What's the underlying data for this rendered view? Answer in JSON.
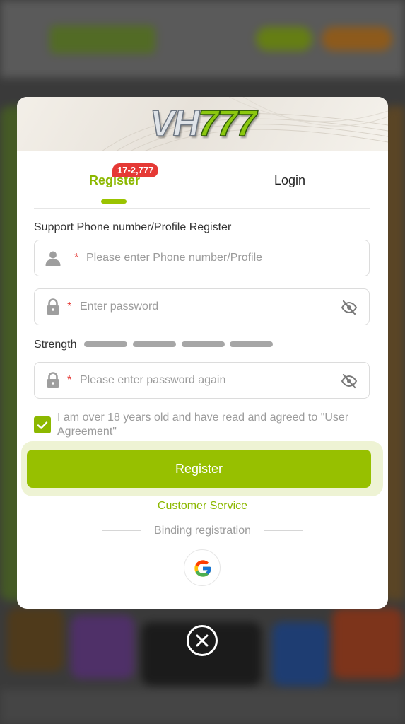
{
  "brand": {
    "logo_letters": "VH",
    "logo_digits": "777"
  },
  "tabs": {
    "register_label": "Register",
    "login_label": "Login",
    "badge": "17-2,777"
  },
  "form": {
    "section_label": "Support Phone number/Profile Register",
    "required_mark": "*",
    "phone_placeholder": "Please enter Phone number/Profile",
    "password_placeholder": "Enter password",
    "confirm_placeholder": "Please enter password again",
    "strength_label": "Strength",
    "strength_level": 0,
    "strength_segments": 4,
    "agreement_checked": true,
    "agreement_text": "I am over 18 years old and have read and agreed to \"User Agreement\"",
    "register_button": "Register"
  },
  "footer": {
    "customer_service": "Customer Service",
    "binding_label": "Binding registration",
    "social": [
      "google-icon"
    ]
  },
  "colors": {
    "accent": "#97c000",
    "badge": "#e53935",
    "required": "#e53935"
  }
}
